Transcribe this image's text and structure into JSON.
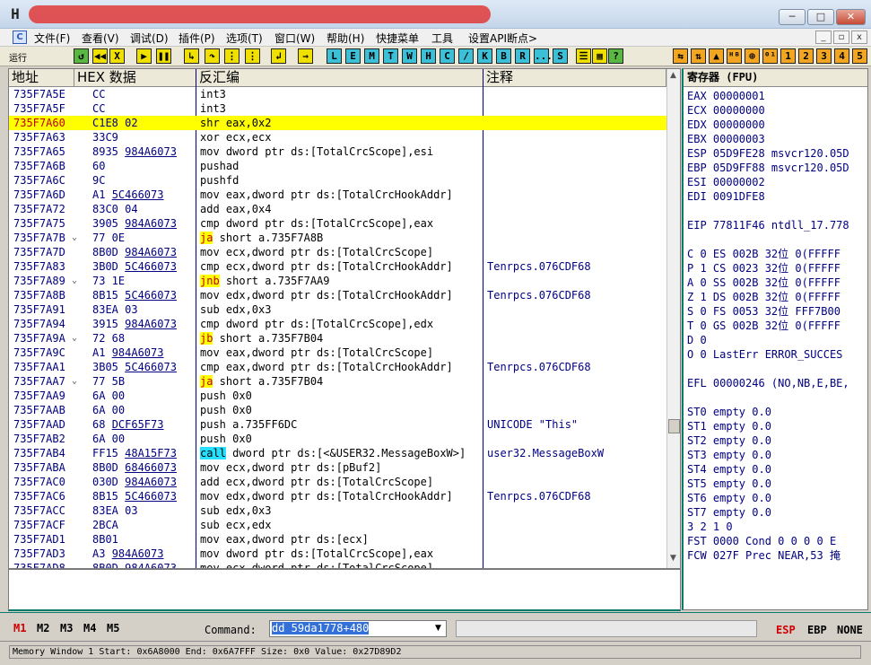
{
  "menu": {
    "icon": "C",
    "items": [
      "文件(F)",
      "查看(V)",
      "调试(D)",
      "插件(P)",
      "选项(T)",
      "窗口(W)",
      "帮助(H)",
      "快捷菜单",
      "工具",
      "设置API断点>"
    ]
  },
  "toolbar": {
    "status": "运行",
    "icon_names": [
      "rewind-icon",
      "close-x-icon",
      "play-icon",
      "pause-icon",
      "step-into-icon",
      "step-over-icon",
      "trace-into-icon",
      "trace-over-icon",
      "execute-till-return-icon",
      "goto-icon"
    ],
    "letters": [
      "L",
      "E",
      "M",
      "T",
      "W",
      "H",
      "C",
      "/",
      "K",
      "B",
      "R",
      "...",
      "S"
    ],
    "right_digits": [
      "1",
      "2",
      "3",
      "4",
      "5"
    ]
  },
  "columns": {
    "address": "地址",
    "hex": "HEX 数据",
    "disasm": "反汇编",
    "comment": "注释"
  },
  "rows": [
    {
      "addr": "735F7A5E",
      "hex": "CC",
      "dis": "int3",
      "cmt": ""
    },
    {
      "addr": "735F7A5F",
      "hex": "CC",
      "dis": "int3",
      "cmt": ""
    },
    {
      "addr": "735F7A60",
      "hex": "C1E8 02",
      "dis": "shr eax,0x2",
      "cmt": "",
      "selected": true
    },
    {
      "addr": "735F7A63",
      "hex": "33C9",
      "dis": "xor ecx,ecx",
      "cmt": ""
    },
    {
      "addr": "735F7A65",
      "hex": "8935 984A6073",
      "dis": "mov dword ptr ds:[TotalCrcScope],esi",
      "cmt": ""
    },
    {
      "addr": "735F7A6B",
      "hex": "60",
      "dis": "pushad",
      "cmt": ""
    },
    {
      "addr": "735F7A6C",
      "hex": "9C",
      "dis": "pushfd",
      "cmt": ""
    },
    {
      "addr": "735F7A6D",
      "hex": "A1 5C466073",
      "dis": "mov eax,dword ptr ds:[TotalCrcHookAddr]",
      "cmt": ""
    },
    {
      "addr": "735F7A72",
      "hex": "83C0 04",
      "dis": "add eax,0x4",
      "cmt": ""
    },
    {
      "addr": "735F7A75",
      "hex": "3905 984A6073",
      "dis": "cmp dword ptr ds:[TotalCrcScope],eax",
      "cmt": ""
    },
    {
      "addr": "735F7A7B",
      "hex": "77 0E",
      "dis": "ja short a.735F7A8B",
      "cmt": "",
      "jump": "ja"
    },
    {
      "addr": "735F7A7D",
      "hex": "8B0D 984A6073",
      "dis": "mov ecx,dword ptr ds:[TotalCrcScope]",
      "cmt": ""
    },
    {
      "addr": "735F7A83",
      "hex": "3B0D 5C466073",
      "dis": "cmp ecx,dword ptr ds:[TotalCrcHookAddr]",
      "cmt": "Tenrpcs.076CDF68"
    },
    {
      "addr": "735F7A89",
      "hex": "73 1E",
      "dis": "jnb short a.735F7AA9",
      "cmt": "",
      "jump": "jnb"
    },
    {
      "addr": "735F7A8B",
      "hex": "8B15 5C466073",
      "dis": "mov edx,dword ptr ds:[TotalCrcHookAddr]",
      "cmt": "Tenrpcs.076CDF68"
    },
    {
      "addr": "735F7A91",
      "hex": "83EA 03",
      "dis": "sub edx,0x3",
      "cmt": ""
    },
    {
      "addr": "735F7A94",
      "hex": "3915 984A6073",
      "dis": "cmp dword ptr ds:[TotalCrcScope],edx",
      "cmt": ""
    },
    {
      "addr": "735F7A9A",
      "hex": "72 68",
      "dis": "jb short a.735F7B04",
      "cmt": "",
      "jump": "jb"
    },
    {
      "addr": "735F7A9C",
      "hex": "A1 984A6073",
      "dis": "mov eax,dword ptr ds:[TotalCrcScope]",
      "cmt": ""
    },
    {
      "addr": "735F7AA1",
      "hex": "3B05 5C466073",
      "dis": "cmp eax,dword ptr ds:[TotalCrcHookAddr]",
      "cmt": "Tenrpcs.076CDF68"
    },
    {
      "addr": "735F7AA7",
      "hex": "77 5B",
      "dis": "ja short a.735F7B04",
      "cmt": "",
      "jump": "ja"
    },
    {
      "addr": "735F7AA9",
      "hex": "6A 00",
      "dis": "push 0x0",
      "cmt": ""
    },
    {
      "addr": "735F7AAB",
      "hex": "6A 00",
      "dis": "push 0x0",
      "cmt": ""
    },
    {
      "addr": "735F7AAD",
      "hex": "68 DCF65F73",
      "dis": "push a.735FF6DC",
      "cmt": "UNICODE \"This\""
    },
    {
      "addr": "735F7AB2",
      "hex": "6A 00",
      "dis": "push 0x0",
      "cmt": ""
    },
    {
      "addr": "735F7AB4",
      "hex": "FF15 48A15F73",
      "dis": "call dword ptr ds:[<&USER32.MessageBoxW>]",
      "cmt": "user32.MessageBoxW",
      "call": true
    },
    {
      "addr": "735F7ABA",
      "hex": "8B0D 68466073",
      "dis": "mov ecx,dword ptr ds:[pBuf2]",
      "cmt": ""
    },
    {
      "addr": "735F7AC0",
      "hex": "030D 984A6073",
      "dis": "add ecx,dword ptr ds:[TotalCrcScope]",
      "cmt": ""
    },
    {
      "addr": "735F7AC6",
      "hex": "8B15 5C466073",
      "dis": "mov edx,dword ptr ds:[TotalCrcHookAddr]",
      "cmt": "Tenrpcs.076CDF68"
    },
    {
      "addr": "735F7ACC",
      "hex": "83EA 03",
      "dis": "sub edx,0x3",
      "cmt": ""
    },
    {
      "addr": "735F7ACF",
      "hex": "2BCA",
      "dis": "sub ecx,edx",
      "cmt": ""
    },
    {
      "addr": "735F7AD1",
      "hex": "8B01",
      "dis": "mov eax,dword ptr ds:[ecx]",
      "cmt": ""
    },
    {
      "addr": "735F7AD3",
      "hex": "A3 984A6073",
      "dis": "mov dword ptr ds:[TotalCrcScope],eax",
      "cmt": ""
    },
    {
      "addr": "735F7AD8",
      "hex": "8B0D 984A6073",
      "dis": "mov ecx,dword ptr ds:[TotalCrcScope]",
      "cmt": ""
    }
  ],
  "registers": {
    "title": "寄存器 (FPU)",
    "lines": [
      "EAX 00000001",
      "ECX 00000000",
      "EDX 00000000",
      "EBX 00000003",
      "ESP 05D9FE28 msvcr120.05D",
      "EBP 05D9FF88 msvcr120.05D",
      "ESI 00000002",
      "EDI 0091DFE8",
      "",
      "EIP 77811F46 ntdll_17.778",
      "",
      "C 0  ES 002B 32位 0(FFFFF",
      "P 1  CS 0023 32位 0(FFFFF",
      "A 0  SS 002B 32位 0(FFFFF",
      "Z 1  DS 002B 32位 0(FFFFF",
      "S 0  FS 0053 32位 FFF7B00",
      "T 0  GS 002B 32位 0(FFFFF",
      "D 0",
      "O 0  LastErr ERROR_SUCCES",
      "",
      "EFL 00000246 (NO,NB,E,BE,",
      "",
      "ST0 empty 0.0",
      "ST1 empty 0.0",
      "ST2 empty 0.0",
      "ST3 empty 0.0",
      "ST4 empty 0.0",
      "ST5 empty 0.0",
      "ST6 empty 0.0",
      "ST7 empty 0.0",
      "               3 2 1 0",
      "FST 0000  Cond 0 0 0 0  E",
      "FCW 027F  Prec NEAR,53  掩"
    ]
  },
  "command": {
    "windows": [
      "M1",
      "M2",
      "M3",
      "M4",
      "M5"
    ],
    "label": "Command:",
    "value": "dd 59da1778+480",
    "modes": [
      "ESP",
      "EBP",
      "NONE"
    ]
  },
  "status": "Memory Window 1  Start: 0x6A8000  End: 0x6A7FFF  Size: 0x0 Value: 0x27D89D2",
  "colors": {
    "accent": "#0a7a6a",
    "selection": "#ffff00",
    "jump": "#c00000",
    "call": "#25e0ff"
  }
}
